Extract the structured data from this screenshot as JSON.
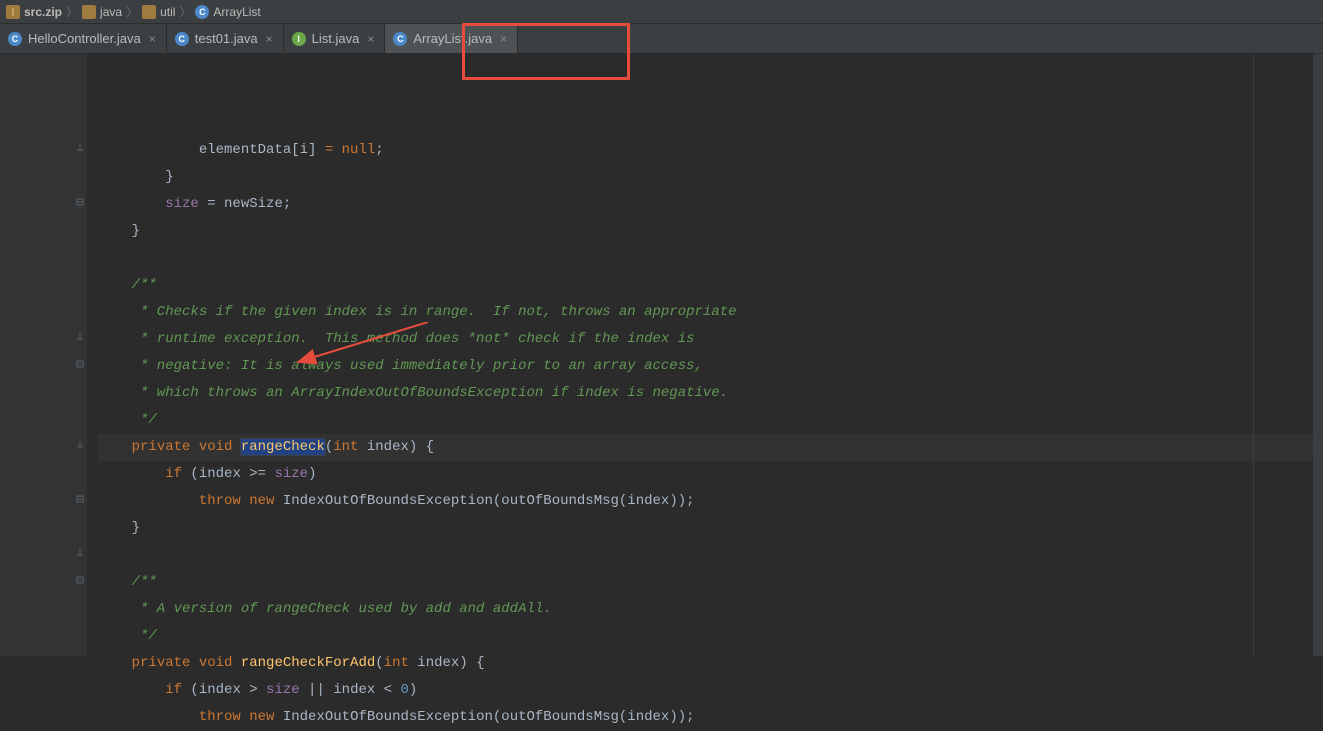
{
  "breadcrumb": {
    "items": [
      {
        "label": "src.zip",
        "iconType": "zip"
      },
      {
        "label": "java",
        "iconType": "folder"
      },
      {
        "label": "util",
        "iconType": "folder"
      },
      {
        "label": "ArrayList",
        "iconType": "class"
      }
    ]
  },
  "tabs": [
    {
      "label": "HelloController.java",
      "iconType": "class",
      "active": false
    },
    {
      "label": "test01.java",
      "iconType": "class-lib",
      "active": false
    },
    {
      "label": "List.java",
      "iconType": "interface",
      "active": false
    },
    {
      "label": "ArrayList.java",
      "iconType": "class-lib",
      "active": true
    }
  ],
  "code": {
    "lines": [
      {
        "html": "            elementData[i] <span class='kw'>= null</span>;"
      },
      {
        "html": "        }"
      },
      {
        "html": "        <span class='field'>size</span> = newSize;"
      },
      {
        "html": "    }",
        "fold": "end"
      },
      {
        "html": ""
      },
      {
        "html": "    <span class='comment'>/**</span>",
        "fold": "start"
      },
      {
        "html": "<span class='comment'>     * Checks if the given index is in range.  If not, throws an appropriate</span>"
      },
      {
        "html": "<span class='comment'>     * runtime exception.  This method does *not* check if the index is</span>"
      },
      {
        "html": "<span class='comment'>     * negative: It is always used immediately prior to an array access,</span>"
      },
      {
        "html": "<span class='comment'>     * which throws an ArrayIndexOutOfBoundsException if index is negative.</span>"
      },
      {
        "html": "<span class='comment'>     */</span>",
        "fold": "end"
      },
      {
        "html": "    <span class='kw'>private void </span><span class='caret-highlight method'>rangeCheck</span>(<span class='kw'>int</span> index) {",
        "fold": "start",
        "highlight": true
      },
      {
        "html": "        <span class='kw'>if</span> (index &gt;= <span class='field'>size</span>)"
      },
      {
        "html": "            <span class='kw'>throw new</span> IndexOutOfBoundsException(outOfBoundsMsg(index));"
      },
      {
        "html": "    }",
        "fold": "end"
      },
      {
        "html": ""
      },
      {
        "html": "    <span class='comment'>/**</span>",
        "fold": "start"
      },
      {
        "html": "<span class='comment'>     * A version of rangeCheck used by add and addAll.</span>"
      },
      {
        "html": "<span class='comment'>     */</span>",
        "fold": "end"
      },
      {
        "html": "    <span class='kw'>private void</span> <span class='method'>rangeCheckForAdd</span>(<span class='kw'>int</span> index) {",
        "fold": "start"
      },
      {
        "html": "        <span class='kw'>if</span> (index &gt; <span class='field'>size</span> || index &lt; <span class='num'>0</span>)"
      },
      {
        "html": "            <span class='kw'>throw new</span> IndexOutOfBoundsException(outOfBoundsMsg(index));"
      }
    ]
  }
}
